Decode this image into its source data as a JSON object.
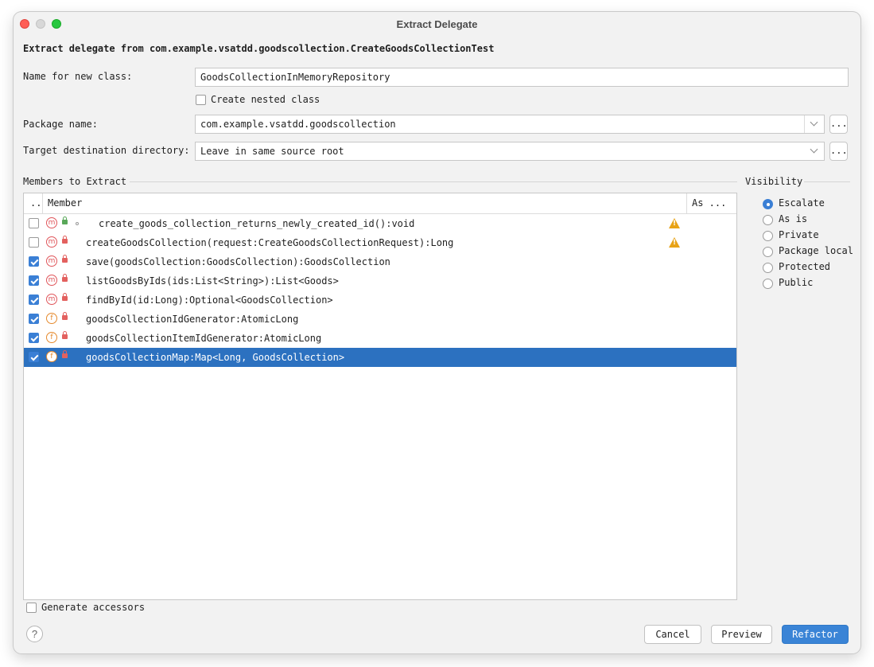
{
  "window": {
    "title": "Extract Delegate"
  },
  "header": {
    "text": "Extract delegate from com.example.vsatdd.goodscollection.CreateGoodsCollectionTest"
  },
  "form": {
    "name_label": "Name for new class:",
    "name_value": "GoodsCollectionInMemoryRepository",
    "nested_label": "Create nested class",
    "nested_checked": false,
    "package_label": "Package name:",
    "package_value": "com.example.vsatdd.goodscollection",
    "package_browse": "...",
    "target_label": "Target destination directory:",
    "target_value": "Leave in same source root",
    "target_browse": "..."
  },
  "members": {
    "section_label": "Members to Extract",
    "col_check": "..",
    "col_member": "Member",
    "col_as": "As ...",
    "rows": [
      {
        "checked": false,
        "kind": "m",
        "text": "create_goods_collection_returns_newly_created_id():void",
        "warning": true,
        "selected": false
      },
      {
        "checked": false,
        "kind": "m",
        "text": "createGoodsCollection(request:CreateGoodsCollectionRequest):Long",
        "warning": true,
        "selected": false
      },
      {
        "checked": true,
        "kind": "m",
        "text": "save(goodsCollection:GoodsCollection):GoodsCollection",
        "warning": false,
        "selected": false
      },
      {
        "checked": true,
        "kind": "m",
        "text": "listGoodsByIds(ids:List<String>):List<Goods>",
        "warning": false,
        "selected": false
      },
      {
        "checked": true,
        "kind": "m",
        "text": "findById(id:Long):Optional<GoodsCollection>",
        "warning": false,
        "selected": false
      },
      {
        "checked": true,
        "kind": "f",
        "text": "goodsCollectionIdGenerator:AtomicLong",
        "warning": false,
        "selected": false
      },
      {
        "checked": true,
        "kind": "f",
        "text": "goodsCollectionItemIdGenerator:AtomicLong",
        "warning": false,
        "selected": false
      },
      {
        "checked": true,
        "kind": "f",
        "text": "goodsCollectionMap:Map<Long, GoodsCollection>",
        "warning": false,
        "selected": true
      }
    ]
  },
  "visibility": {
    "label": "Visibility",
    "options": [
      "Escalate",
      "As is",
      "Private",
      "Package local",
      "Protected",
      "Public"
    ],
    "selected": "Escalate"
  },
  "footer": {
    "generate_accessors": "Generate accessors",
    "help": "?",
    "cancel": "Cancel",
    "preview": "Preview",
    "refactor": "Refactor"
  },
  "colors": {
    "accent": "#3a7fd5",
    "selection": "#2c71c0",
    "warning": "#e8a317"
  }
}
